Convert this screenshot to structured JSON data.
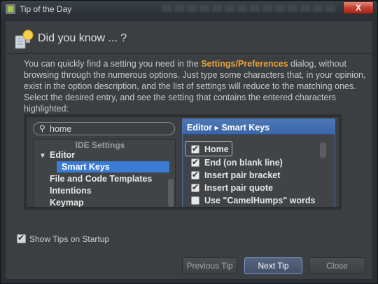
{
  "window": {
    "title": "Tip of the Day",
    "close_label": "X"
  },
  "header": {
    "title": "Did you know ... ?"
  },
  "tip": {
    "before": "You can quickly find a setting you need in the ",
    "highlight": "Settings/Preferences",
    "after": " dialog, without browsing through the numerous options. Just type some characters that, in your opinion, exist in the option description, and the list of settings will reduce to the matching ones. Select the desired entry, and see the setting that contains the entered characters highlighted:"
  },
  "illustration": {
    "search": {
      "value": "home",
      "glyph": "🔍"
    },
    "tree": {
      "header": "IDE Settings",
      "items": [
        {
          "label": "Editor",
          "expanded": true
        },
        {
          "label": "Smart Keys",
          "selected": true
        },
        {
          "label": "File and Code Templates"
        },
        {
          "label": "Intentions"
        },
        {
          "label": "Keymap"
        }
      ]
    },
    "right_panel": {
      "breadcrumb": "Editor ▸ Smart Keys",
      "options": [
        {
          "label": "Home",
          "checked": true
        },
        {
          "label": "End (on blank line)",
          "checked": true
        },
        {
          "label": "Insert pair bracket",
          "checked": true
        },
        {
          "label": "Insert pair quote",
          "checked": true
        },
        {
          "label": "Use \"CamelHumps\" words",
          "checked": false
        }
      ]
    }
  },
  "footer": {
    "show_tips_label": "Show Tips on Startup",
    "show_tips_checked": true
  },
  "buttons": {
    "previous": "Previous Tip",
    "next": "Next Tip",
    "close": "Close"
  },
  "colors": {
    "highlight": "#e8a33d",
    "selection": "#3b7bd3",
    "accent_header": "#4d78b8",
    "close_button": "#c0392b"
  }
}
